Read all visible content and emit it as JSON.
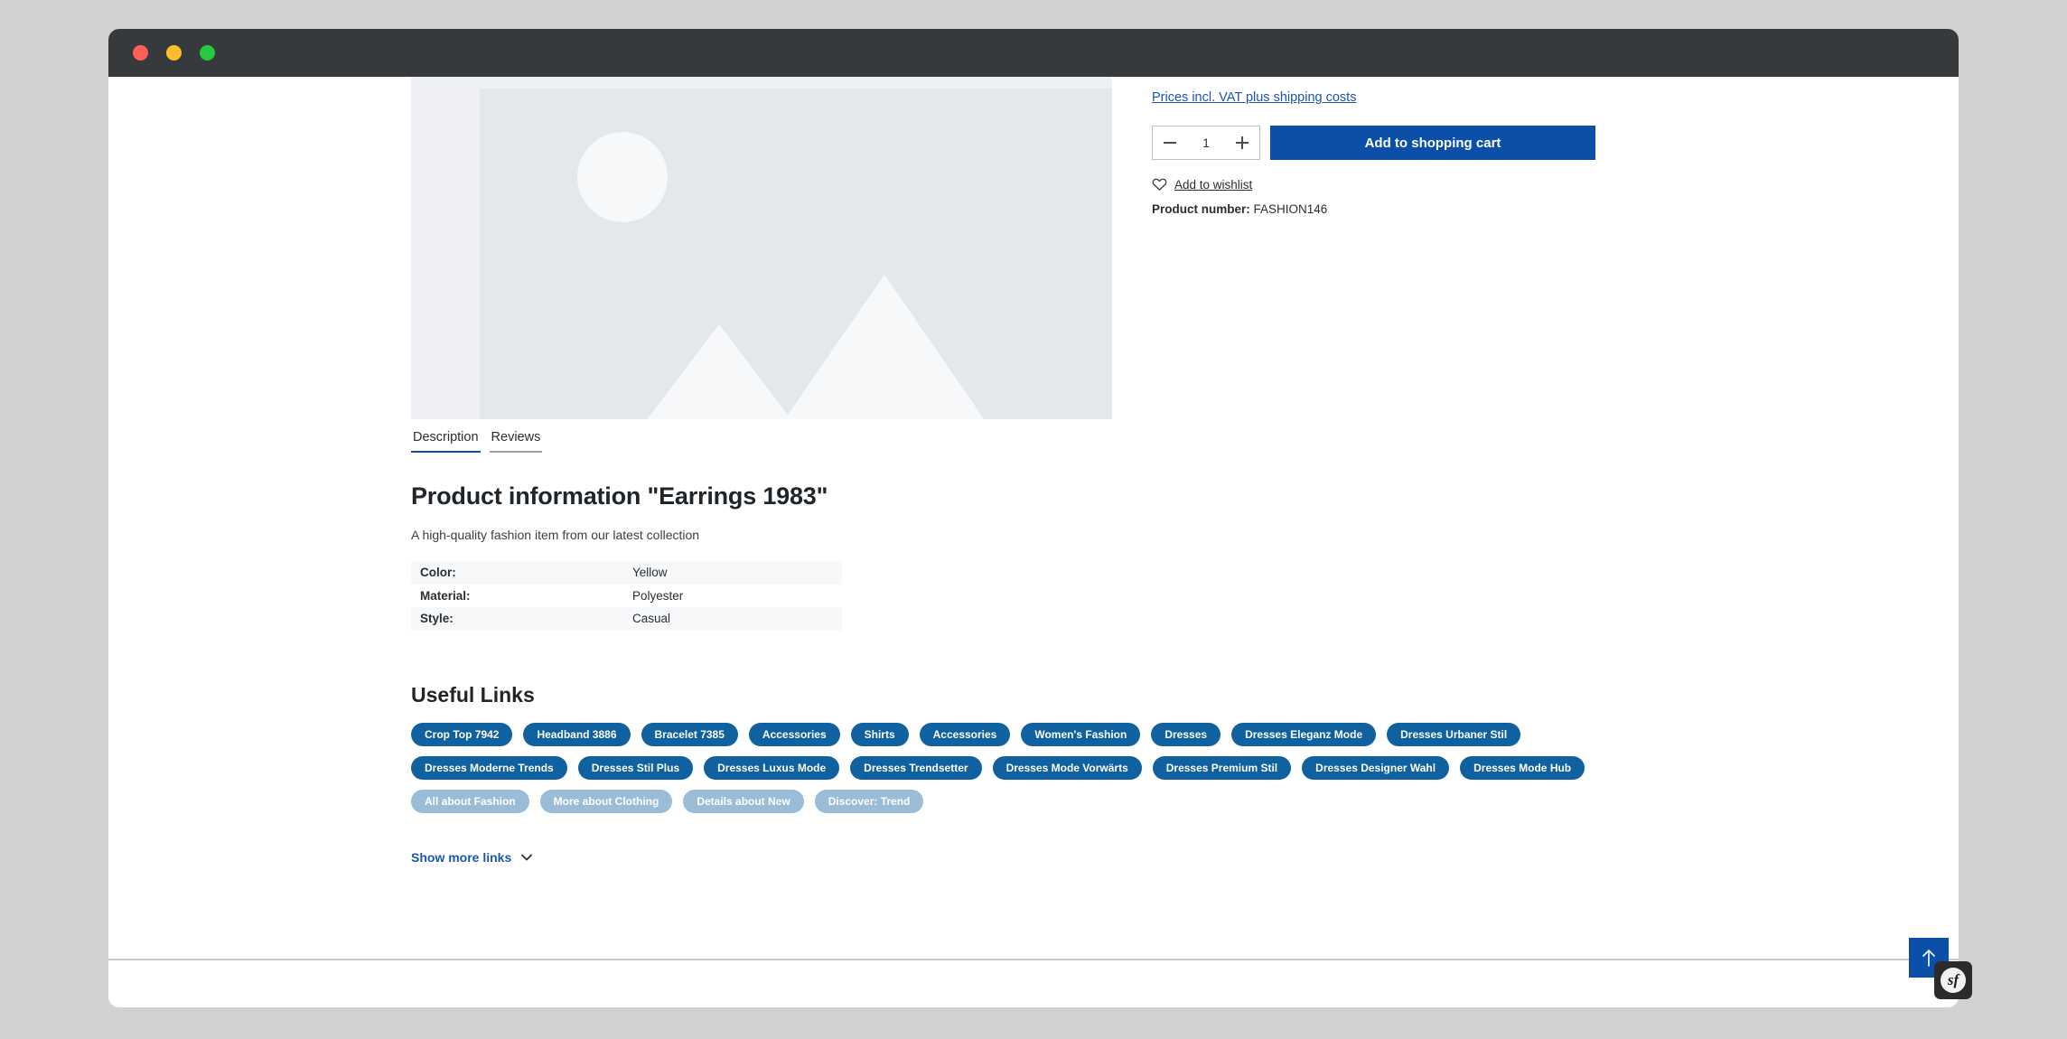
{
  "window": {
    "controls": [
      {
        "name": "close",
        "color": "#ff5f56"
      },
      {
        "name": "minimize",
        "color": "#ffbd2e"
      },
      {
        "name": "maximize",
        "color": "#27c93f"
      }
    ]
  },
  "buy_box": {
    "vat_notice": "Prices incl. VAT plus shipping costs",
    "quantity_value": "1",
    "decrease_label": "−",
    "increase_label": "+",
    "add_to_cart_label": "Add to shopping cart",
    "wishlist_label": "Add to wishlist",
    "product_number_label": "Product number:",
    "product_number_value": "FASHION146"
  },
  "tabs": [
    {
      "label": "Description",
      "active": true
    },
    {
      "label": "Reviews",
      "active": false
    }
  ],
  "description": {
    "heading": "Product information \"Earrings 1983\"",
    "text": "A high-quality fashion item from our latest collection"
  },
  "properties": {
    "rows": [
      {
        "key": "Color:",
        "value": "Yellow"
      },
      {
        "key": "Material:",
        "value": "Polyester"
      },
      {
        "key": "Style:",
        "value": "Casual"
      }
    ]
  },
  "useful_links": {
    "heading": "Useful Links",
    "rows": [
      {
        "faded": false,
        "tags": [
          "Crop Top 7942",
          "Headband 3886",
          "Bracelet 7385",
          "Accessories",
          "Shirts",
          "Accessories",
          "Women's Fashion",
          "Dresses",
          "Dresses Eleganz Mode",
          "Dresses Urbaner Stil"
        ]
      },
      {
        "faded": false,
        "tags": [
          "Dresses Moderne Trends",
          "Dresses Stil Plus",
          "Dresses Luxus Mode",
          "Dresses Trendsetter",
          "Dresses Mode Vorwärts",
          "Dresses Premium Stil",
          "Dresses Designer Wahl",
          "Dresses Mode Hub"
        ]
      },
      {
        "faded": true,
        "tags": [
          "All about Fashion",
          "More about Clothing",
          "Details about New",
          "Discover: Trend"
        ]
      }
    ],
    "show_more_label": "Show more links"
  },
  "widgets": {
    "scroll_top_name": "scroll-to-top",
    "profiler_name": "symfony-profiler",
    "profiler_logo_text": "sf"
  },
  "colors": {
    "accent_blue": "#0b4fa8",
    "tag_blue": "#10619f",
    "link_blue": "#1a56b0",
    "titlebar": "#373a3c",
    "page_backdrop": "#d2d2d2"
  }
}
